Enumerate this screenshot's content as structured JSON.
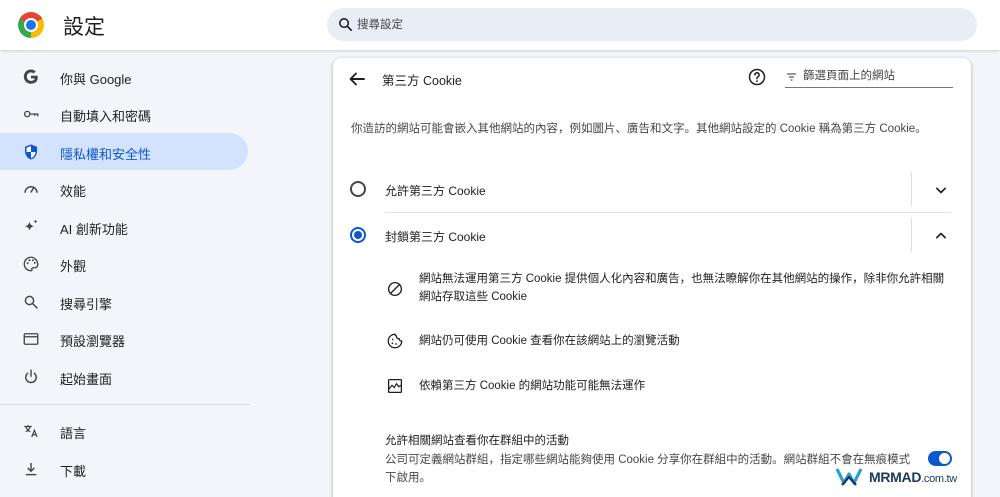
{
  "header": {
    "app_title": "設定",
    "search_placeholder": "搜尋設定"
  },
  "sidebar": {
    "items": [
      {
        "label": "你與 Google",
        "icon": "google-g-icon"
      },
      {
        "label": "自動填入和密碼",
        "icon": "key-icon"
      },
      {
        "label": "隱私權和安全性",
        "icon": "shield-icon",
        "active": true
      },
      {
        "label": "效能",
        "icon": "speedometer-icon"
      },
      {
        "label": "AI 創新功能",
        "icon": "sparkle-icon"
      },
      {
        "label": "外觀",
        "icon": "palette-icon"
      },
      {
        "label": "搜尋引擎",
        "icon": "search-icon"
      },
      {
        "label": "預設瀏覽器",
        "icon": "browser-window-icon"
      },
      {
        "label": "起始畫面",
        "icon": "power-icon"
      },
      {
        "label": "語言",
        "icon": "translate-icon"
      },
      {
        "label": "下載",
        "icon": "download-icon"
      }
    ]
  },
  "panel": {
    "title": "第三方 Cookie",
    "filter_placeholder": "篩選頁面上的網站",
    "description": "你造訪的網站可能會嵌入其他網站的內容，例如圖片、廣告和文字。其他網站設定的 Cookie 稱為第三方 Cookie。",
    "options": [
      {
        "label": "允許第三方 Cookie",
        "checked": false,
        "expanded": false
      },
      {
        "label": "封鎖第三方 Cookie",
        "checked": true,
        "expanded": true
      }
    ],
    "details": [
      {
        "icon": "block-icon",
        "text": "網站無法運用第三方 Cookie 提供個人化內容和廣告，也無法瞭解你在其他網站的操作，除非你允許相關網站存取這些 Cookie"
      },
      {
        "icon": "cookie-icon",
        "text": "網站仍可使用 Cookie 查看你在該網站上的瀏覽活動"
      },
      {
        "icon": "broken-image-icon",
        "text": "依賴第三方 Cookie 的網站功能可能無法運作"
      }
    ],
    "related_sets": {
      "title": "允許相關網站查看你在群組中的活動",
      "description": "公司可定義網站群組，指定哪些網站能夠使用 Cookie 分享你在群組中的活動。網站群組不會在無痕模式下啟用。",
      "enabled": true
    }
  },
  "watermark": {
    "brand": "MRMAD",
    "domain": ".com.tw"
  },
  "colors": {
    "accent": "#0b57d0",
    "active_nav_bg": "#d3e3fd",
    "page_bg": "#f3f5fa"
  }
}
